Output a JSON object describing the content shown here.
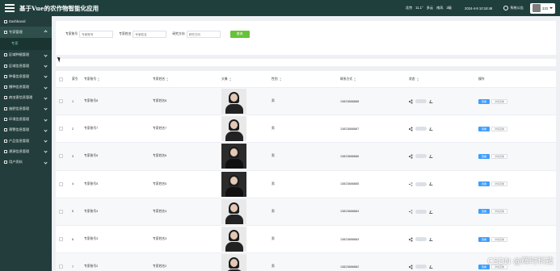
{
  "header": {
    "app_title": "基于Vue的农作物智能化应用",
    "weather_city": "北京",
    "weather_temp": "11.1°",
    "weather_desc": "多云",
    "weather_wind": "南风",
    "weather_level": "2级",
    "datetime": "2024-4-9 10:18:48",
    "notice_label": "系统公告",
    "user_label": "333"
  },
  "sidebar": {
    "items": [
      {
        "label": "Dashboard",
        "icon": "home-icon",
        "expanded": false
      },
      {
        "label": "专家管理",
        "icon": "grid-icon",
        "expanded": true,
        "active": true
      },
      {
        "label": "区域种植管理",
        "icon": "grid-icon",
        "expanded": false
      },
      {
        "label": "区域信息管理",
        "icon": "grid-icon",
        "expanded": false
      },
      {
        "label": "种植信息管理",
        "icon": "grid-icon",
        "expanded": false
      },
      {
        "label": "播种信息管理",
        "icon": "grid-icon",
        "expanded": false
      },
      {
        "label": "病虫害信息管理",
        "icon": "grid-icon",
        "expanded": false
      },
      {
        "label": "施肥信息管理",
        "icon": "grid-icon",
        "expanded": false
      },
      {
        "label": "环境信息管理",
        "icon": "grid-icon",
        "expanded": false
      },
      {
        "label": "预警信息管理",
        "icon": "grid-icon",
        "expanded": false
      },
      {
        "label": "产品信息管理",
        "icon": "grid-icon",
        "expanded": false
      },
      {
        "label": "溯源信息管理",
        "icon": "grid-icon",
        "expanded": false
      },
      {
        "label": "用户资料",
        "icon": "user-icon",
        "expanded": false
      }
    ],
    "sub_item": "专家"
  },
  "search": {
    "fields": [
      {
        "label": "专家账号",
        "placeholder": "专家账号"
      },
      {
        "label": "专家姓名",
        "placeholder": "专家姓名"
      },
      {
        "label": "研究方向",
        "placeholder": "研究方向"
      }
    ],
    "button_label": "查询"
  },
  "table": {
    "columns": [
      "",
      "索引",
      "专家账号",
      "专家姓名",
      "头像",
      "性别",
      "联系方式",
      "状态",
      "操作"
    ],
    "view_label": "查看",
    "edit_label": "详情查看",
    "rows": [
      {
        "index": "1",
        "account": "专家账号8",
        "name": "专家姓名8",
        "gender": "男",
        "phone": "13823888888",
        "photo": "light"
      },
      {
        "index": "2",
        "account": "专家账号7",
        "name": "专家姓名7",
        "gender": "男",
        "phone": "13823888887",
        "photo": "light"
      },
      {
        "index": "3",
        "account": "专家账号6",
        "name": "专家姓名6",
        "gender": "男",
        "phone": "13823888886",
        "photo": "dark"
      },
      {
        "index": "4",
        "account": "专家账号5",
        "name": "专家姓名5",
        "gender": "男",
        "phone": "13823888885",
        "photo": "dark"
      },
      {
        "index": "5",
        "account": "专家账号4",
        "name": "专家姓名4",
        "gender": "男",
        "phone": "13823888884",
        "photo": "light"
      },
      {
        "index": "6",
        "account": "专家账号3",
        "name": "专家姓名3",
        "gender": "男",
        "phone": "13823888883",
        "photo": "light"
      },
      {
        "index": "7",
        "account": "专家账号2",
        "name": "专家姓名2",
        "gender": "男",
        "phone": "13823888882",
        "photo": "light"
      }
    ]
  },
  "watermark": "CSDN @辉时科技",
  "colors": {
    "header_bg": "#1f3f3d",
    "sidebar_bg": "#223d3b",
    "search_button": "#67c23a",
    "view_button": "#409eff"
  }
}
